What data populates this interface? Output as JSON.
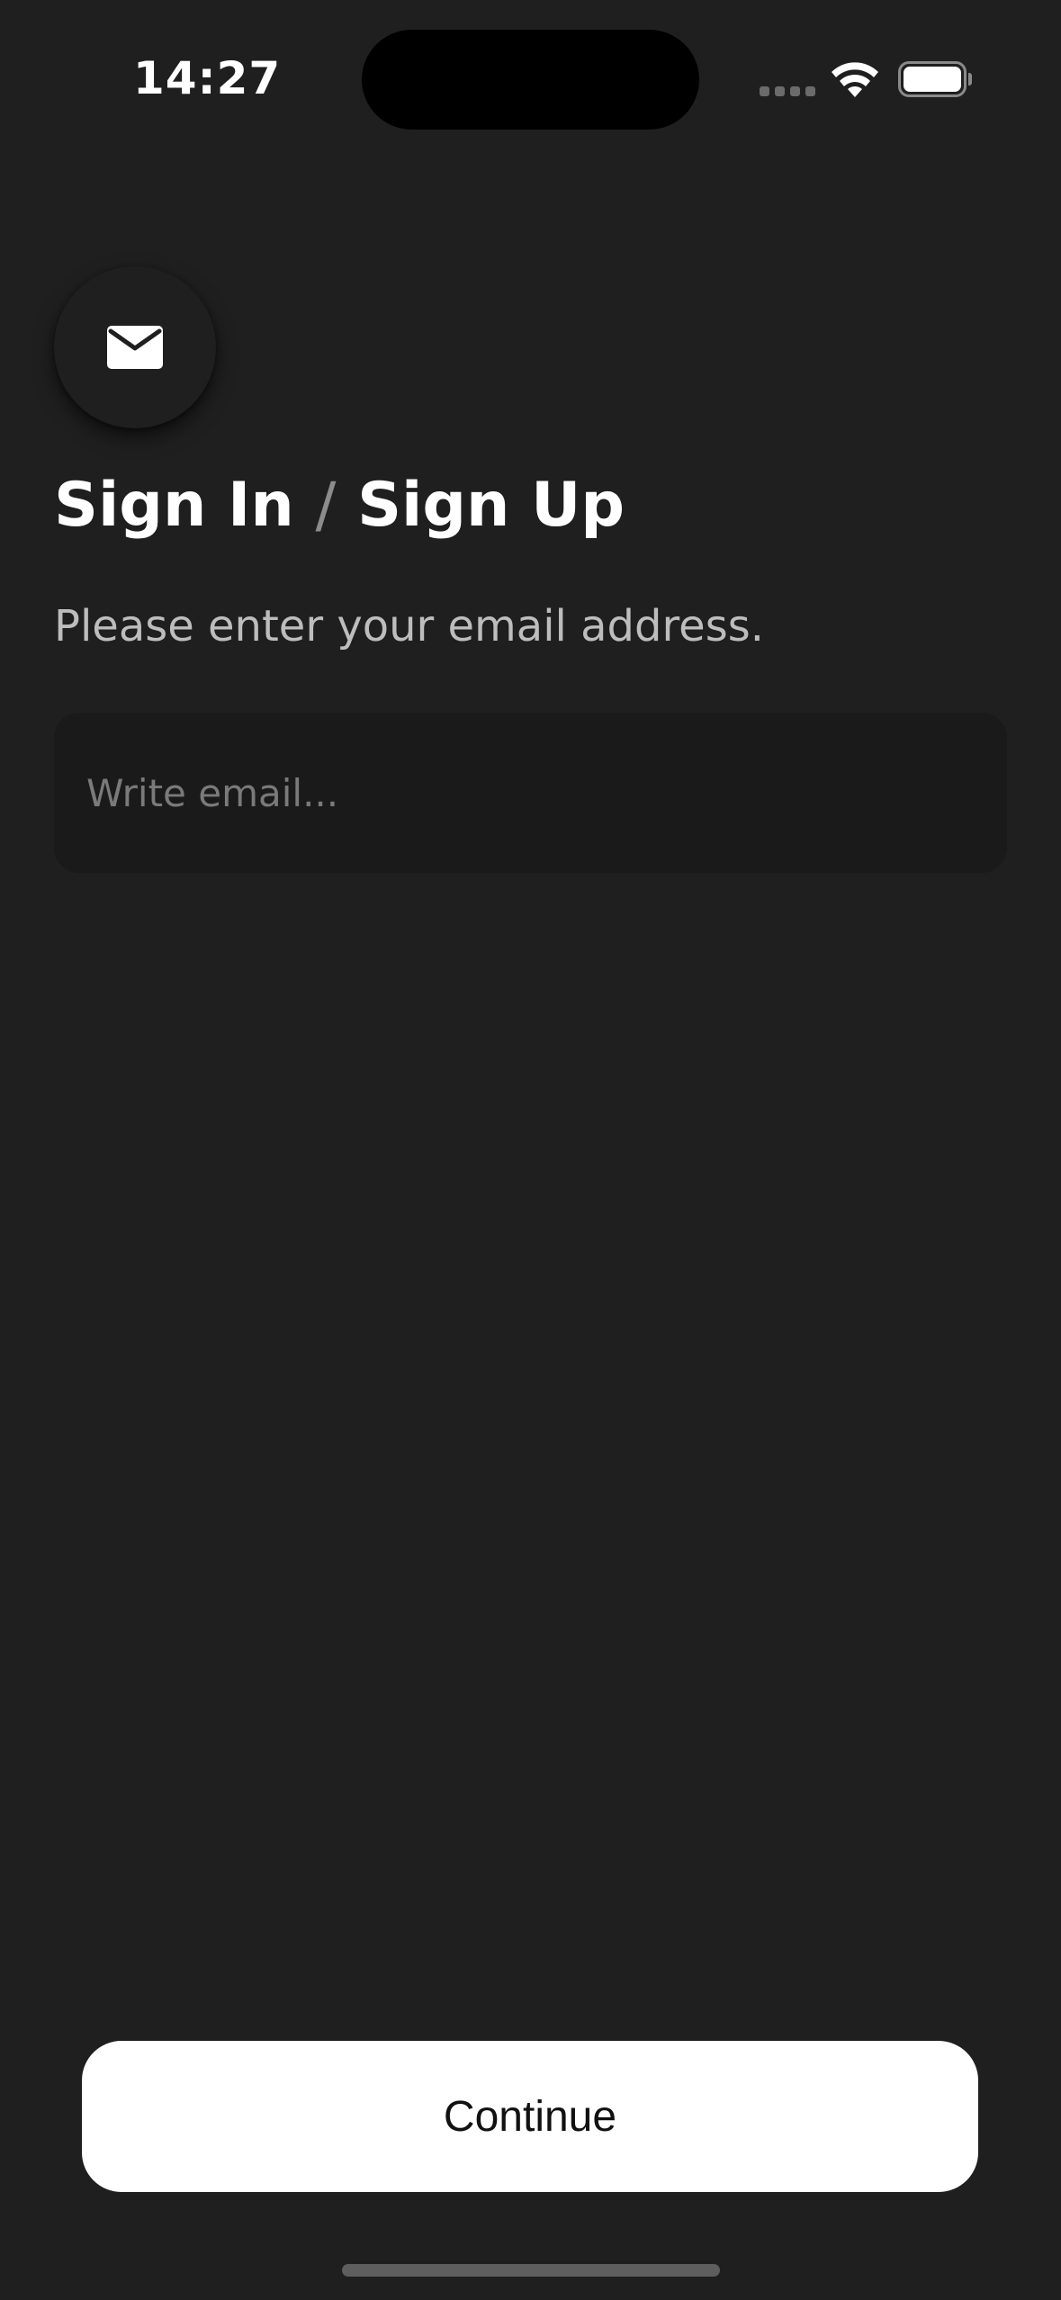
{
  "status_bar": {
    "time": "14:27"
  },
  "header": {
    "icon": "mail-icon",
    "title_part1": "Sign In",
    "title_separator": "/",
    "title_part2": "Sign Up",
    "subtitle": "Please enter your email address."
  },
  "email_field": {
    "value": "",
    "placeholder": "Write email..."
  },
  "actions": {
    "continue_label": "Continue"
  },
  "colors": {
    "background": "#1f1f1f",
    "input_background": "#1a1a1a",
    "button_background": "#ffffff",
    "button_text": "#111111"
  }
}
